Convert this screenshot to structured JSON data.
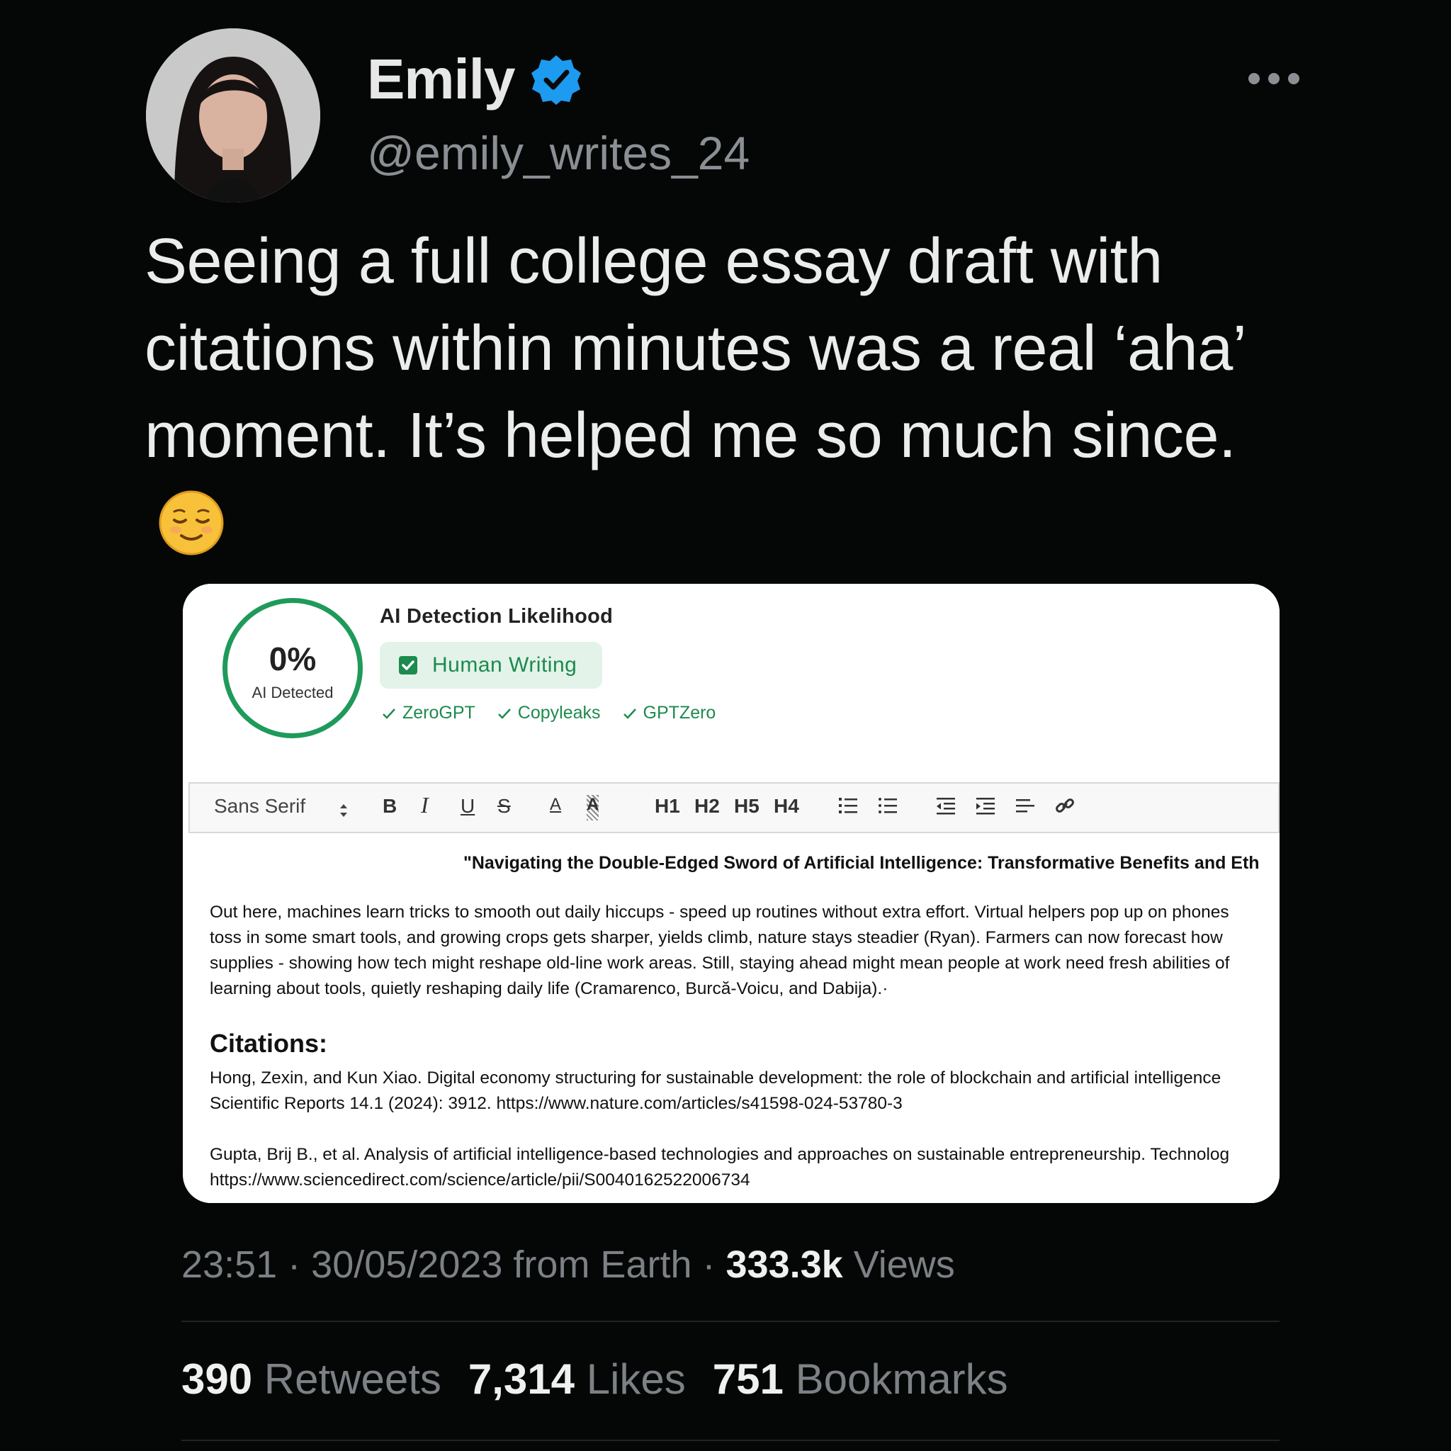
{
  "author": {
    "display_name": "Emily",
    "handle": "@emily_writes_24",
    "verified_icon": "verified-badge-icon",
    "avatar": "profile-photo"
  },
  "tweet": {
    "text": "Seeing a full college essay draft with citations within minutes was a real ‘aha’ moment. It’s helped me so much since.",
    "emoji": "relieved-face-emoji"
  },
  "screenshot": {
    "detector": {
      "percent": "0%",
      "percent_label": "AI Detected",
      "title": "AI Detection Likelihood",
      "badge": "Human Writing",
      "checkers": [
        "ZeroGPT",
        "Copyleaks",
        "GPTZero"
      ],
      "accent_color": "#1e9a5a"
    },
    "toolbar": {
      "font": "Sans Serif",
      "bold": "B",
      "italic": "I",
      "underline": "U",
      "strike": "S",
      "font_color": "A",
      "highlight": "A",
      "h1": "H1",
      "h2": "H2",
      "h3": "H5",
      "h4": "H4"
    },
    "essay": {
      "title": "\"Navigating the Double-Edged Sword of Artificial Intelligence: Transformative Benefits and Eth",
      "lines": [
        "Out here, machines learn tricks to smooth out daily hiccups - speed up routines without extra effort. Virtual helpers pop up on phones",
        "toss in some smart tools, and growing crops gets sharper, yields climb, nature stays steadier (Ryan). Farmers can now forecast how",
        "supplies - showing how tech might reshape old-line work areas. Still, staying ahead might mean people at work need fresh abilities of",
        "learning about tools, quietly reshaping daily life (Cramarenco, Burcă-Voicu, and Dabija).·"
      ]
    },
    "citations": {
      "heading": "Citations:",
      "entries": [
        {
          "line1": "Hong, Zexin, and Kun Xiao. Digital economy structuring for sustainable development: the role of blockchain and artificial intelligence",
          "line2": "Scientific Reports 14.1 (2024): 3912. https://www.nature.com/articles/s41598-024-53780-3"
        },
        {
          "line1": "Gupta, Brij B., et al. Analysis of artificial intelligence-based technologies and approaches on sustainable entrepreneurship. Technolog",
          "line2": "https://www.sciencedirect.com/science/article/pii/S0040162522006734"
        }
      ]
    }
  },
  "meta": {
    "time": "23:51",
    "date_source": "30/05/2023 from Earth",
    "views_count": "333.3k",
    "views_label": "Views"
  },
  "stats": {
    "retweets_count": "390",
    "retweets_label": "Retweets",
    "likes_count": "7,314",
    "likes_label": "Likes",
    "bookmarks_count": "751",
    "bookmarks_label": "Bookmarks"
  }
}
